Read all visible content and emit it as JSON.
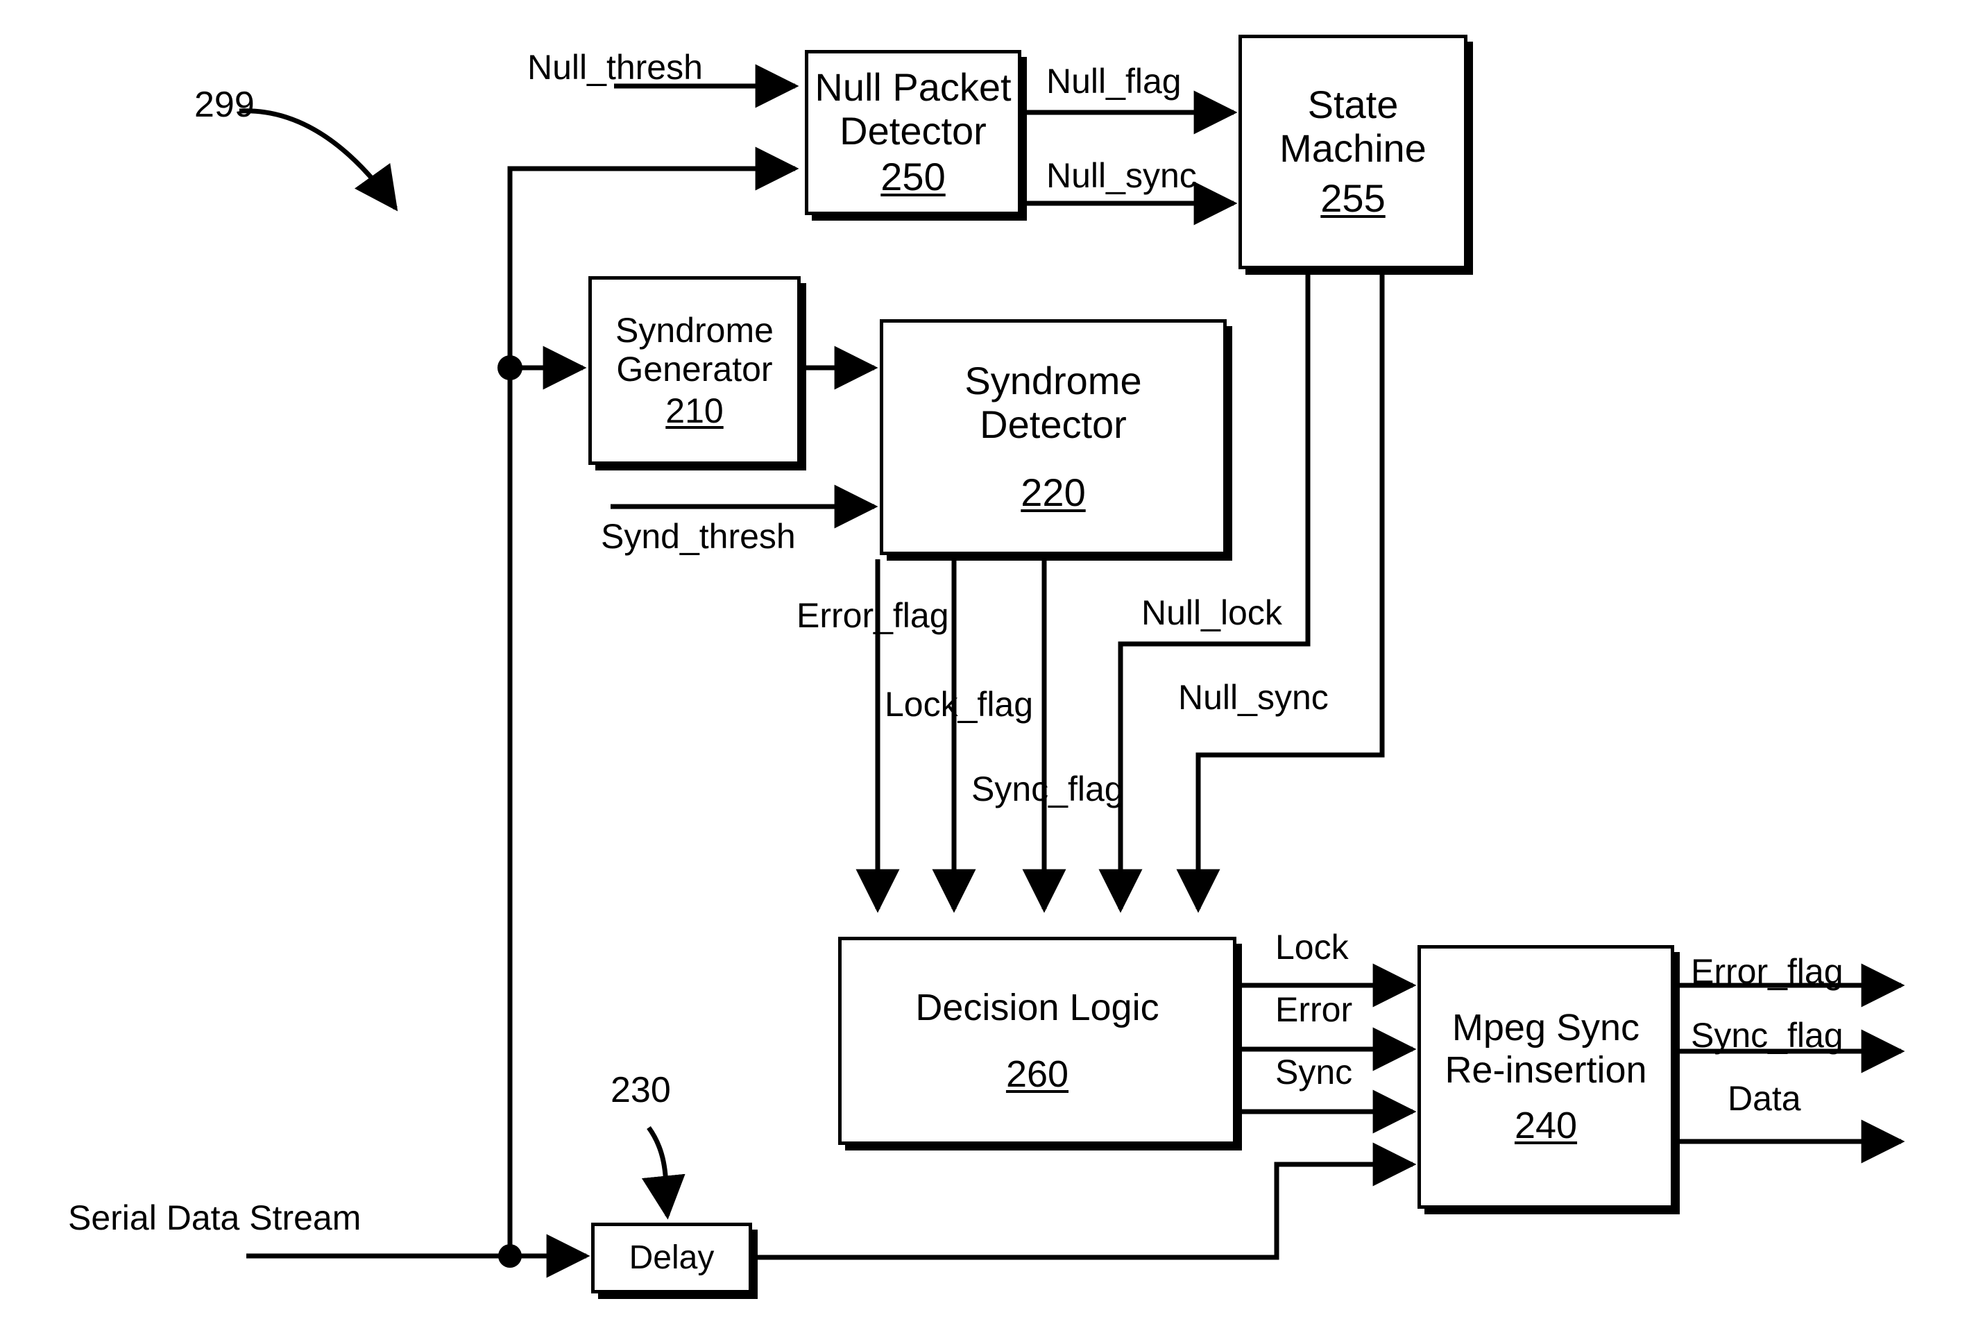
{
  "figure": {
    "reference_numeral": "299",
    "delay_reference_numeral": "230"
  },
  "blocks": [
    {
      "id": "null_packet_detector",
      "title": "Null Packet\nDetector",
      "number": "250"
    },
    {
      "id": "state_machine",
      "title": "State\nMachine",
      "number": "255"
    },
    {
      "id": "syndrome_generator",
      "title": "Syndrome\nGenerator",
      "number": "210"
    },
    {
      "id": "syndrome_detector",
      "title": "Syndrome\nDetector",
      "number": "220"
    },
    {
      "id": "decision_logic",
      "title": "Decision Logic",
      "number": "260"
    },
    {
      "id": "mpeg_sync_reinsertion",
      "title": "Mpeg Sync\nRe-insertion",
      "number": "240"
    },
    {
      "id": "delay",
      "title": "Delay",
      "number": ""
    }
  ],
  "signals": {
    "null_thresh": "Null_thresh",
    "null_flag": "Null_flag",
    "null_sync_top": "Null_sync",
    "synd_thresh": "Synd_thresh",
    "error_flag_mid": "Error_flag",
    "lock_flag": "Lock_flag",
    "sync_flag": "Sync_flag",
    "null_lock": "Null_lock",
    "null_sync_mid": "Null_sync",
    "lock": "Lock",
    "error": "Error",
    "sync": "Sync",
    "error_flag_out": "Error_flag",
    "sync_flag_out": "Sync_flag",
    "data_out": "Data",
    "serial_data_stream": "Serial Data Stream"
  },
  "colors": {
    "line": "#000000",
    "background": "#ffffff",
    "text": "#000000"
  }
}
